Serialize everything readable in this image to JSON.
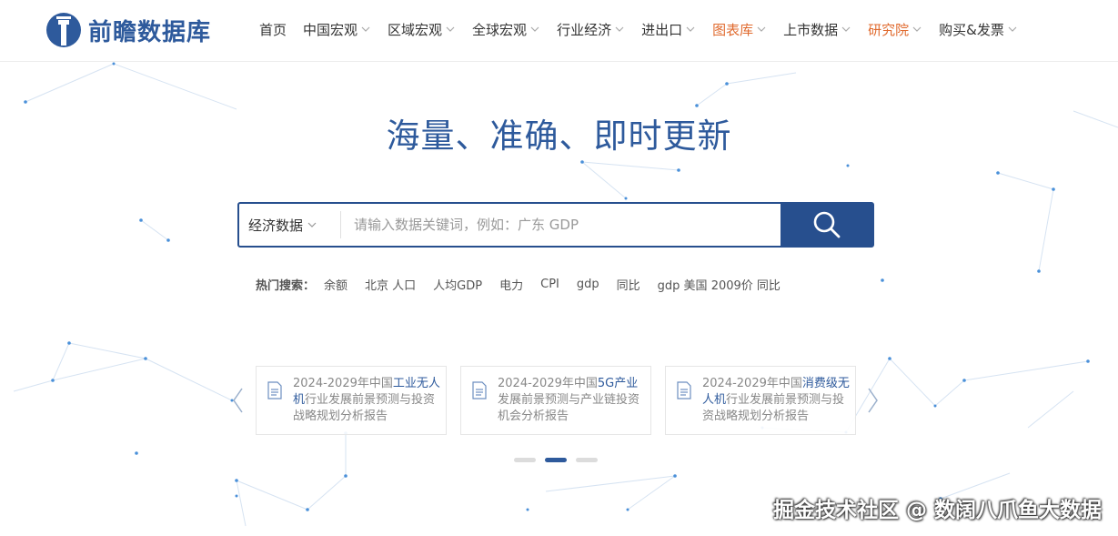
{
  "brand": {
    "name": "前瞻数据库"
  },
  "nav": {
    "items": [
      {
        "label": "首页",
        "dropdown": false,
        "accent": false
      },
      {
        "label": "中国宏观",
        "dropdown": true,
        "accent": false
      },
      {
        "label": "区域宏观",
        "dropdown": true,
        "accent": false
      },
      {
        "label": "全球宏观",
        "dropdown": true,
        "accent": false
      },
      {
        "label": "行业经济",
        "dropdown": true,
        "accent": false
      },
      {
        "label": "进出口",
        "dropdown": true,
        "accent": false
      },
      {
        "label": "图表库",
        "dropdown": true,
        "accent": true
      },
      {
        "label": "上市数据",
        "dropdown": true,
        "accent": false
      },
      {
        "label": "研究院",
        "dropdown": true,
        "accent": true
      },
      {
        "label": "购买&发票",
        "dropdown": true,
        "accent": false
      }
    ]
  },
  "hero": {
    "title": "海量、准确、即时更新"
  },
  "search": {
    "category": "经济数据",
    "placeholder": "请输入数据关键词，例如：广东 GDP",
    "button_icon": "search-icon"
  },
  "hot_search": {
    "label": "热门搜索：",
    "links": [
      "余额",
      "北京 人口",
      "人均GDP",
      "电力",
      "CPI",
      "gdp",
      "同比",
      "gdp 美国 2009价 同比"
    ]
  },
  "reports": [
    {
      "pre": "2024-2029年中国",
      "highlight": "工业无人机",
      "post": "行业发展前景预测与投资战略规划分析报告"
    },
    {
      "pre": "2024-2029年中国",
      "highlight": "5G产业",
      "post": "发展前景预测与产业链投资机会分析报告"
    },
    {
      "pre": "2024-2029年中国",
      "highlight": "消费级无人机",
      "post": "行业发展前景预测与投资战略规划分析报告"
    }
  ],
  "carousel": {
    "pages": 3,
    "active_index": 1
  },
  "watermark": "掘金技术社区 @ 数阔八爪鱼大数据",
  "colors": {
    "brand_blue": "#2e5a9c",
    "button_blue": "#274f8e",
    "accent_orange": "#e06a2e",
    "network_dot": "#4a90d9"
  }
}
